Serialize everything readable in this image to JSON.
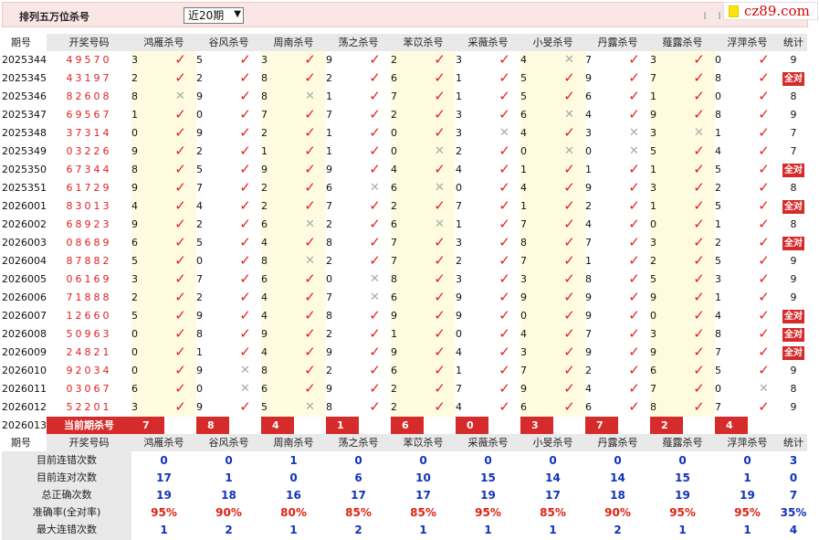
{
  "header": {
    "title": "排列五万位杀号",
    "period_select": "近20期",
    "site_logo": "cz89.com"
  },
  "columns": {
    "period": "期号",
    "winning": "开奖号码",
    "experts": [
      "鸿雁杀号",
      "谷风杀号",
      "周南杀号",
      "荡之杀号",
      "苯苡杀号",
      "采薇杀号",
      "小旻杀号",
      "丹露杀号",
      "薤露杀号",
      "浮萍杀号"
    ],
    "total": "统计"
  },
  "rows": [
    {
      "period": "2025344",
      "num": "49570",
      "d": [
        3,
        5,
        3,
        9,
        2,
        3,
        4,
        7,
        3,
        0
      ],
      "ok": [
        1,
        1,
        1,
        1,
        1,
        1,
        0,
        1,
        1,
        1
      ],
      "tot": "9"
    },
    {
      "period": "2025345",
      "num": "43197",
      "d": [
        2,
        2,
        8,
        2,
        6,
        1,
        5,
        9,
        7,
        8
      ],
      "ok": [
        1,
        1,
        1,
        1,
        1,
        1,
        1,
        1,
        1,
        1
      ],
      "tot": "全对"
    },
    {
      "period": "2025346",
      "num": "82608",
      "d": [
        8,
        9,
        8,
        1,
        7,
        1,
        5,
        6,
        1,
        0
      ],
      "ok": [
        0,
        1,
        0,
        1,
        1,
        1,
        1,
        1,
        1,
        1
      ],
      "tot": "8"
    },
    {
      "period": "2025347",
      "num": "69567",
      "d": [
        1,
        0,
        7,
        7,
        2,
        3,
        6,
        4,
        9,
        8
      ],
      "ok": [
        1,
        1,
        1,
        1,
        1,
        1,
        0,
        1,
        1,
        1
      ],
      "tot": "9"
    },
    {
      "period": "2025348",
      "num": "37314",
      "d": [
        0,
        9,
        2,
        1,
        0,
        3,
        4,
        3,
        3,
        1
      ],
      "ok": [
        1,
        1,
        1,
        1,
        1,
        0,
        1,
        0,
        0,
        1
      ],
      "tot": "7"
    },
    {
      "period": "2025349",
      "num": "03226",
      "d": [
        9,
        2,
        1,
        1,
        0,
        2,
        0,
        0,
        5,
        4
      ],
      "ok": [
        1,
        1,
        1,
        1,
        0,
        1,
        0,
        0,
        1,
        1
      ],
      "tot": "7"
    },
    {
      "period": "2025350",
      "num": "67344",
      "d": [
        8,
        5,
        9,
        9,
        4,
        4,
        1,
        1,
        1,
        5
      ],
      "ok": [
        1,
        1,
        1,
        1,
        1,
        1,
        1,
        1,
        1,
        1
      ],
      "tot": "全对"
    },
    {
      "period": "2025351",
      "num": "61729",
      "d": [
        9,
        7,
        2,
        6,
        6,
        0,
        4,
        9,
        3,
        2
      ],
      "ok": [
        1,
        1,
        1,
        0,
        0,
        1,
        1,
        1,
        1,
        1
      ],
      "tot": "8"
    },
    {
      "period": "2026001",
      "num": "83013",
      "d": [
        4,
        4,
        2,
        7,
        2,
        7,
        1,
        2,
        1,
        5
      ],
      "ok": [
        1,
        1,
        1,
        1,
        1,
        1,
        1,
        1,
        1,
        1
      ],
      "tot": "全对"
    },
    {
      "period": "2026002",
      "num": "68923",
      "d": [
        9,
        2,
        6,
        2,
        6,
        1,
        7,
        4,
        0,
        1
      ],
      "ok": [
        1,
        1,
        0,
        1,
        0,
        1,
        1,
        1,
        1,
        1
      ],
      "tot": "8"
    },
    {
      "period": "2026003",
      "num": "08689",
      "d": [
        6,
        5,
        4,
        8,
        7,
        3,
        8,
        7,
        3,
        2
      ],
      "ok": [
        1,
        1,
        1,
        1,
        1,
        1,
        1,
        1,
        1,
        1
      ],
      "tot": "全对"
    },
    {
      "period": "2026004",
      "num": "87882",
      "d": [
        5,
        0,
        8,
        2,
        7,
        2,
        7,
        1,
        2,
        5
      ],
      "ok": [
        1,
        1,
        0,
        1,
        1,
        1,
        1,
        1,
        1,
        1
      ],
      "tot": "9"
    },
    {
      "period": "2026005",
      "num": "06169",
      "d": [
        3,
        7,
        6,
        0,
        8,
        3,
        3,
        8,
        5,
        3
      ],
      "ok": [
        1,
        1,
        1,
        0,
        1,
        1,
        1,
        1,
        1,
        1
      ],
      "tot": "9"
    },
    {
      "period": "2026006",
      "num": "71888",
      "d": [
        2,
        2,
        4,
        7,
        6,
        9,
        9,
        9,
        9,
        1
      ],
      "ok": [
        1,
        1,
        1,
        0,
        1,
        1,
        1,
        1,
        1,
        1
      ],
      "tot": "9"
    },
    {
      "period": "2026007",
      "num": "12660",
      "d": [
        5,
        9,
        4,
        8,
        9,
        9,
        0,
        9,
        0,
        4
      ],
      "ok": [
        1,
        1,
        1,
        1,
        1,
        1,
        1,
        1,
        1,
        1
      ],
      "tot": "全对"
    },
    {
      "period": "2026008",
      "num": "50963",
      "d": [
        0,
        8,
        9,
        2,
        1,
        0,
        4,
        7,
        3,
        8
      ],
      "ok": [
        1,
        1,
        1,
        1,
        1,
        1,
        1,
        1,
        1,
        1
      ],
      "tot": "全对"
    },
    {
      "period": "2026009",
      "num": "24821",
      "d": [
        0,
        1,
        4,
        9,
        9,
        4,
        3,
        9,
        9,
        7
      ],
      "ok": [
        1,
        1,
        1,
        1,
        1,
        1,
        1,
        1,
        1,
        1
      ],
      "tot": "全对"
    },
    {
      "period": "2026010",
      "num": "92034",
      "d": [
        0,
        9,
        8,
        2,
        6,
        1,
        7,
        2,
        6,
        5
      ],
      "ok": [
        1,
        0,
        1,
        1,
        1,
        1,
        1,
        1,
        1,
        1
      ],
      "tot": "9"
    },
    {
      "period": "2026011",
      "num": "03067",
      "d": [
        6,
        0,
        6,
        9,
        2,
        7,
        9,
        4,
        7,
        0
      ],
      "ok": [
        1,
        0,
        1,
        1,
        1,
        1,
        1,
        1,
        1,
        0
      ],
      "tot": "8"
    },
    {
      "period": "2026012",
      "num": "52201",
      "d": [
        3,
        9,
        5,
        8,
        2,
        4,
        6,
        6,
        8,
        7
      ],
      "ok": [
        1,
        1,
        0,
        1,
        1,
        1,
        1,
        1,
        1,
        1
      ],
      "tot": "9"
    }
  ],
  "current": {
    "period": "2026013",
    "label": "当前期杀号",
    "picks": [
      "7",
      "8",
      "4",
      "1",
      "6",
      "0",
      "3",
      "7",
      "2",
      "4"
    ]
  },
  "stats": [
    {
      "label": "目前连错次数",
      "v": [
        "0",
        "0",
        "1",
        "0",
        "0",
        "0",
        "0",
        "0",
        "0",
        "0"
      ],
      "tot": "3"
    },
    {
      "label": "目前连对次数",
      "v": [
        "17",
        "1",
        "0",
        "6",
        "10",
        "15",
        "14",
        "14",
        "15",
        "1"
      ],
      "tot": "0"
    },
    {
      "label": "总正确次数",
      "v": [
        "19",
        "18",
        "16",
        "17",
        "17",
        "19",
        "17",
        "18",
        "19",
        "19"
      ],
      "tot": "7"
    },
    {
      "label": "准确率(全对率)",
      "v": [
        "95%",
        "90%",
        "80%",
        "85%",
        "85%",
        "95%",
        "85%",
        "90%",
        "95%",
        "95%"
      ],
      "tot": "35%",
      "red": true
    },
    {
      "label": "最大连错次数",
      "v": [
        "1",
        "2",
        "1",
        "2",
        "1",
        "1",
        "1",
        "2",
        "1",
        "1"
      ],
      "tot": "4"
    },
    {
      "label": "最大连对次数",
      "v": [
        "17",
        "17",
        "7",
        "7",
        "10",
        "15",
        "14",
        "14",
        "15",
        "18"
      ],
      "tot": "3"
    }
  ],
  "marks": {
    "check": "✓",
    "cross": "✕"
  },
  "colors": {
    "accent": "#d62b2b",
    "header_bg": "#e9e9e9",
    "stat_blue": "#1133bb",
    "alt_col": "#fffbe0"
  }
}
